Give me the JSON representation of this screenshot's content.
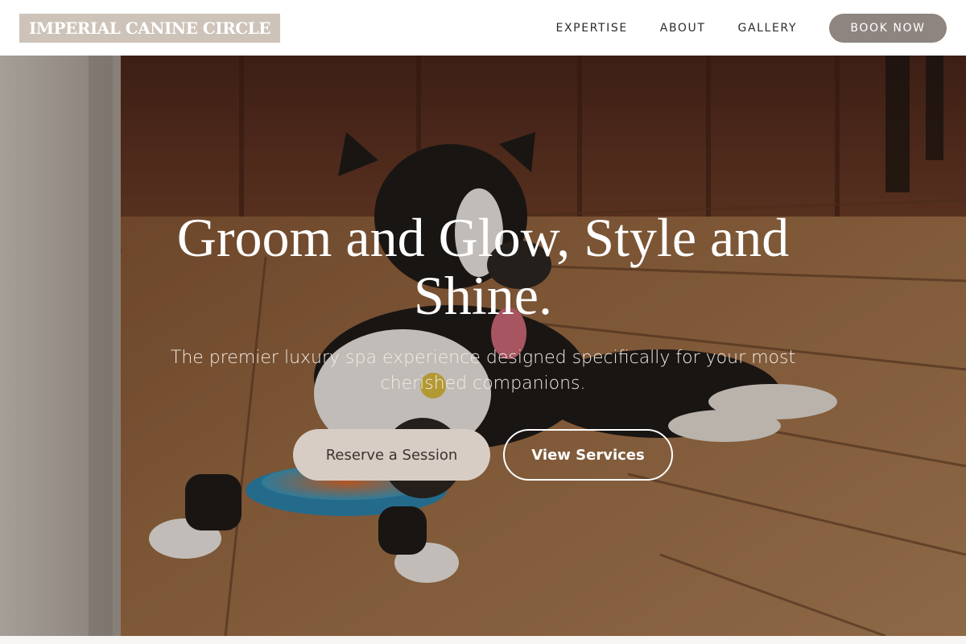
{
  "header": {
    "logo_text": "IMPERIAL CANINE CIRCLE",
    "nav": [
      {
        "label": "EXPERTISE"
      },
      {
        "label": "ABOUT"
      },
      {
        "label": "GALLERY"
      }
    ],
    "cta_label": "BOOK NOW"
  },
  "hero": {
    "title": "Groom and Glow, Style and Shine.",
    "subtitle": "The premier luxury spa experience designed specifically for your most cherished companions.",
    "primary_button": "Reserve a Session",
    "secondary_button": "View Services"
  },
  "colors": {
    "logo_bg": "#cdc3b9",
    "cta_bg": "#8e8580",
    "primary_button_bg": "#d8cdc4",
    "wood_floor": "#8a5a35",
    "wall": "#5a2f22"
  }
}
